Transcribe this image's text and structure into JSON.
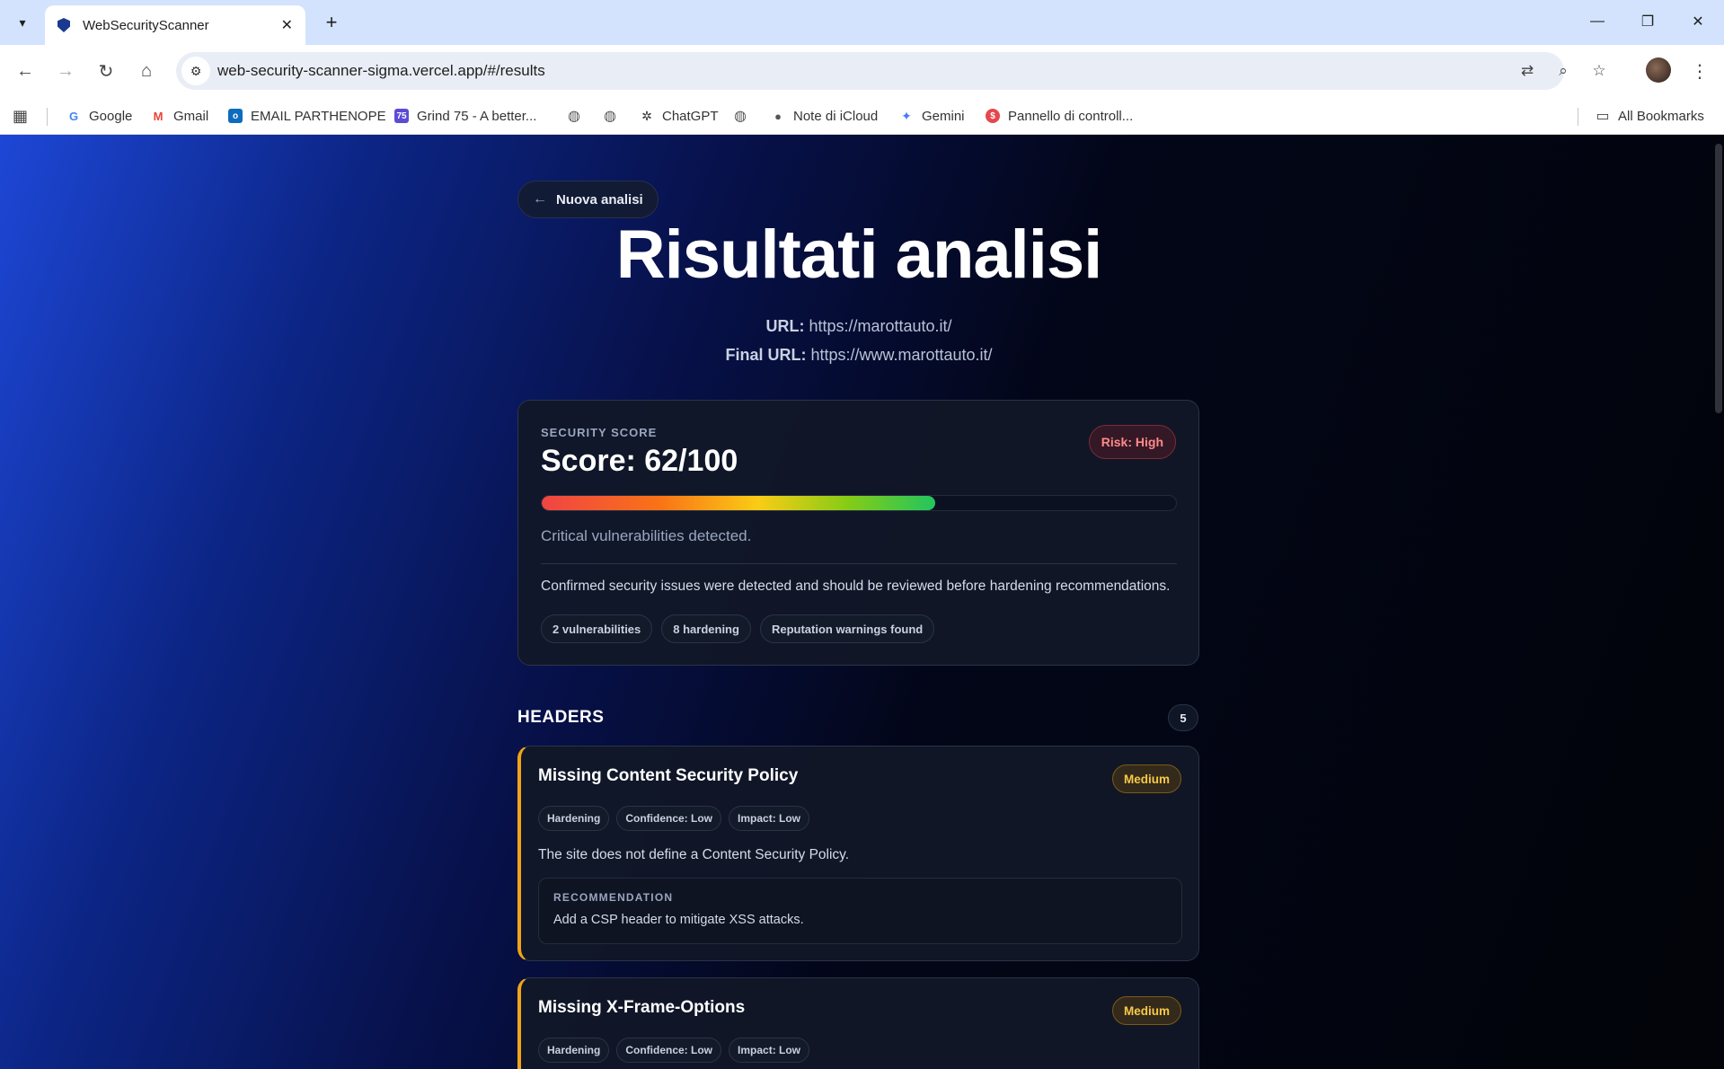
{
  "browser": {
    "tab_title": "WebSecurityScanner",
    "url": "web-security-scanner-sigma.vercel.app/#/results",
    "bookmarks": [
      {
        "label": "Google"
      },
      {
        "label": "Gmail"
      },
      {
        "label": "EMAIL PARTHENOPE"
      },
      {
        "label": "Grind 75 - A better..."
      },
      {
        "label": "ChatGPT"
      },
      {
        "label": "Note di iCloud"
      },
      {
        "label": "Gemini"
      },
      {
        "label": "Pannello di controll..."
      }
    ],
    "all_bookmarks": "All Bookmarks",
    "grind_icon_text": "75"
  },
  "page": {
    "back_label": "Nuova analisi",
    "title": "Risultati analisi",
    "url_label": "URL:",
    "url_value": "https://marottauto.it/",
    "final_url_label": "Final URL:",
    "final_url_value": "https://www.marottauto.it/"
  },
  "score": {
    "section_label": "SECURITY SCORE",
    "title": "Score: 62/100",
    "value": 62,
    "max": 100,
    "risk_label": "Risk: High",
    "summary": "Critical vulnerabilities detected.",
    "details": "Confirmed security issues were detected and should be reviewed before hardening recommendations.",
    "chips": [
      "2 vulnerabilities",
      "8 hardening",
      "Reputation warnings found"
    ]
  },
  "headers_section": {
    "title": "HEADERS",
    "count": "5",
    "findings": [
      {
        "title": "Missing Content Security Policy",
        "severity": "Medium",
        "tags": [
          "Hardening",
          "Confidence: Low",
          "Impact: Low"
        ],
        "description": "The site does not define a Content Security Policy.",
        "recommendation_label": "RECOMMENDATION",
        "recommendation": "Add a CSP header to mitigate XSS attacks."
      },
      {
        "title": "Missing X-Frame-Options",
        "severity": "Medium",
        "tags": [
          "Hardening",
          "Confidence: Low",
          "Impact: Low"
        ]
      }
    ]
  },
  "colors": {
    "accent_orange": "#f0a418",
    "risk_red": "#ff8a8a",
    "medium_yellow": "#f7c948"
  }
}
